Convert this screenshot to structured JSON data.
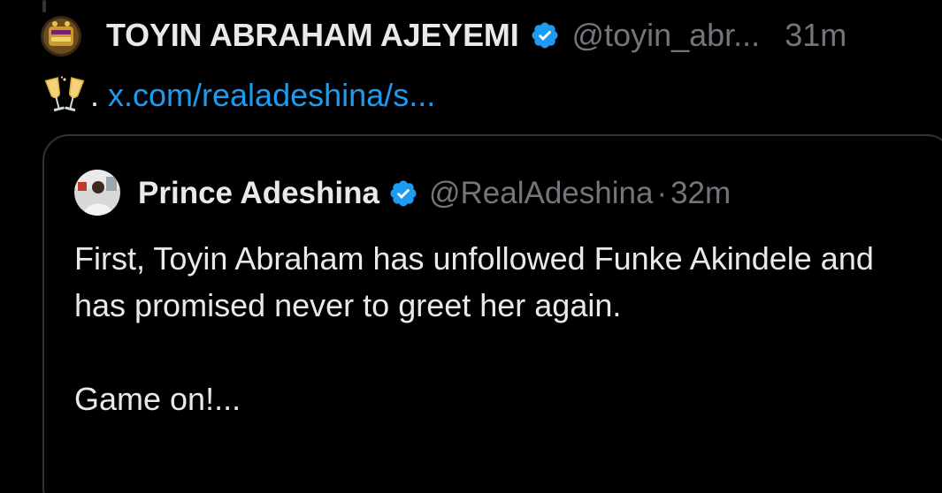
{
  "tweet": {
    "author_name": "TOYIN ABRAHAM AJEYEMI",
    "handle": "@toyin_abr...",
    "time": "31m",
    "emoji": "clinking-glasses-icon",
    "dot": ".",
    "link_text": "x.com/realadeshina/s..."
  },
  "quote": {
    "author_name": "Prince Adeshina",
    "handle": "@RealAdeshina",
    "separator": "·",
    "time": "32m",
    "text_para1": "First, Toyin Abraham has unfollowed Funke Akindele and has promised never to greet her again.",
    "text_para2": "Game on!..."
  },
  "colors": {
    "background": "#000000",
    "text_primary": "#e7e9ea",
    "text_secondary": "#71767b",
    "link": "#1d9bf0",
    "verified_badge": "#1d9bf0",
    "border": "#2f3336"
  }
}
